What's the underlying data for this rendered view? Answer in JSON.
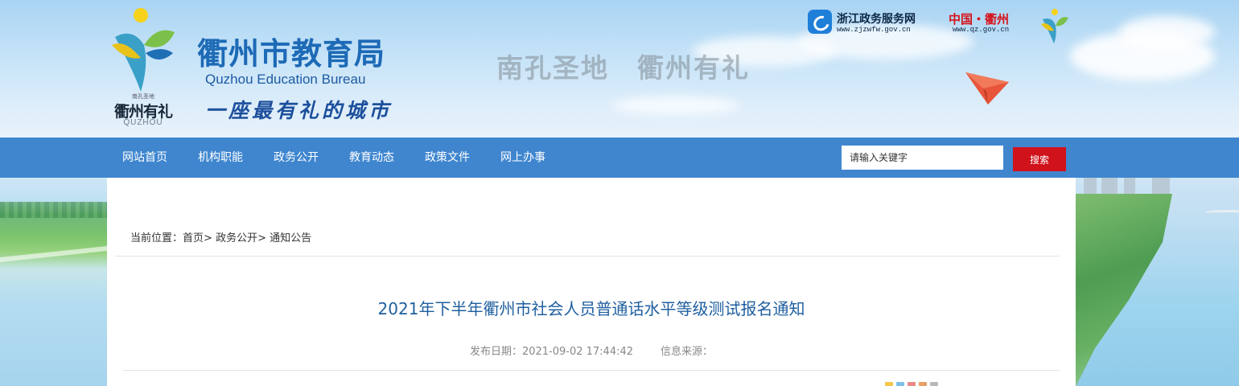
{
  "header": {
    "logo_tiny": "南孔圣地",
    "logo_text": "衢州有礼",
    "logo_sub": "QUZHOU",
    "site_title": "衢州市教育局",
    "site_title_en": "Quzhou Education Bureau",
    "slogan": "一座最有礼的城市",
    "banner_slogan": "南孔圣地　衢州有礼",
    "links": {
      "zj_name": "浙江政务服务网",
      "zj_url": "www.zjzwfw.gov.cn",
      "qz_name": "中国・衢州",
      "qz_url": "www.qz.gov.cn"
    }
  },
  "nav": {
    "items": [
      "网站首页",
      "机构职能",
      "政务公开",
      "教育动态",
      "政策文件",
      "网上办事"
    ],
    "search_placeholder": "请输入关键字",
    "search_button": "搜索"
  },
  "breadcrumb": {
    "prefix": "当前位置：",
    "items": [
      "首页",
      "政务公开",
      "通知公告"
    ],
    "separator": "> "
  },
  "article": {
    "title": "2021年下半年衢州市社会人员普通话水平等级测试报名通知",
    "date_label": "发布日期：",
    "date": "2021-09-02 17:44:42",
    "source_label": "信息来源："
  },
  "colors": {
    "nav_bg": "#3f86cf",
    "search_button_bg": "#d0121b",
    "title_blue": "#1d6ab6",
    "article_title": "#1f5f9f"
  }
}
